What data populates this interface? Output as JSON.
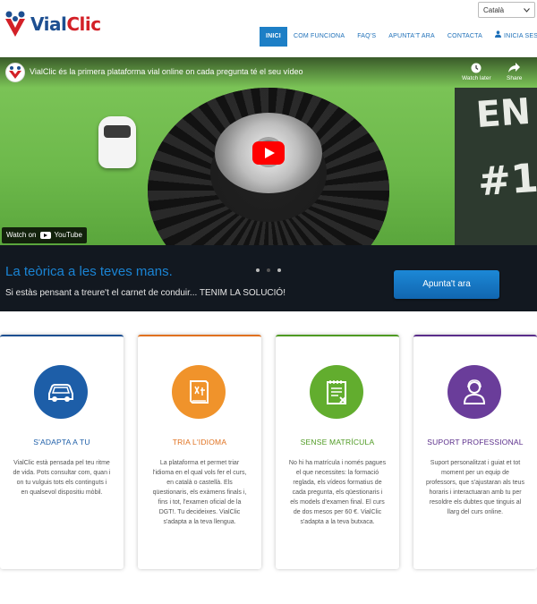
{
  "header": {
    "logo_text_part1": "Vial",
    "logo_text_part2": "Clic",
    "language": "Català",
    "nav": [
      {
        "label": "INICI",
        "active": true
      },
      {
        "label": "COM FUNCIONA",
        "active": false
      },
      {
        "label": "FAQ'S",
        "active": false
      },
      {
        "label": "APUNTA'T ARA",
        "active": false
      },
      {
        "label": "CONTACTA",
        "active": false
      }
    ],
    "login_label": "INICIA SESSIÓ",
    "login_icon": "user-icon"
  },
  "video": {
    "title": "VialClic és la primera plataforma vial online on cada pregunta té el seu vídeo",
    "watch_later_label": "Watch later",
    "share_label": "Share",
    "watch_on_label": "Watch on",
    "watch_on_brand": "YouTube",
    "board_text_line1": "EN",
    "board_text_line2": "#1",
    "colors": {
      "play_button": "#ff0000",
      "grass": "#7fc75a"
    }
  },
  "banner": {
    "title": "La teòrica a les teves mans.",
    "subtitle": "Si estàs pensant a treure't el carnet de conduir... TENIM LA SOLUCIÓ!",
    "button_label": "Apunta't ara",
    "slides_total": 3,
    "slide_active": 2,
    "colors": {
      "title": "#1a84d4",
      "button": "#1874c2",
      "background": "#121820"
    }
  },
  "features": [
    {
      "icon": "car-icon",
      "title": "S'ADAPTA A TU",
      "color": "#1d5ea8",
      "text": "VialClic està pensada pel teu ritme de vida. Pots consultar com, quan i on tu vulguis tots els continguts i en qualsevol dispositiu mòbil."
    },
    {
      "icon": "book-translate-icon",
      "title": "TRIA L'IDIOMA",
      "color": "#f0932b",
      "text": "La plataforma et permet triar l'idioma en el qual vols fer el curs, en català o castellà. Els qüestionaris, els exàmens finals i, fins i tot, l'examen oficial de la DGT!. Tu decideixes. VialClic s'adapta a la teva llengua."
    },
    {
      "icon": "document-cancel-icon",
      "title": "SENSE MATRÍCULA",
      "color": "#62ad2e",
      "text": "No hi ha matrícula i només pagues el que necessites: la formació reglada, els vídeos formatius de cada pregunta, els qüestionaris i els models d'examen final. El curs de dos mesos per 60 €. VialClic s'adapta a la teva butxaca."
    },
    {
      "icon": "support-person-icon",
      "title": "SUPORT PROFESSIONAL",
      "color": "#6a3d9a",
      "text": "Suport personalitzat i guiat et tot moment per un equip de professors, que s'ajustaran als teus horaris i interactuaran amb tu per resoldre els dubtes que tinguis al llarg del curs online."
    }
  ]
}
